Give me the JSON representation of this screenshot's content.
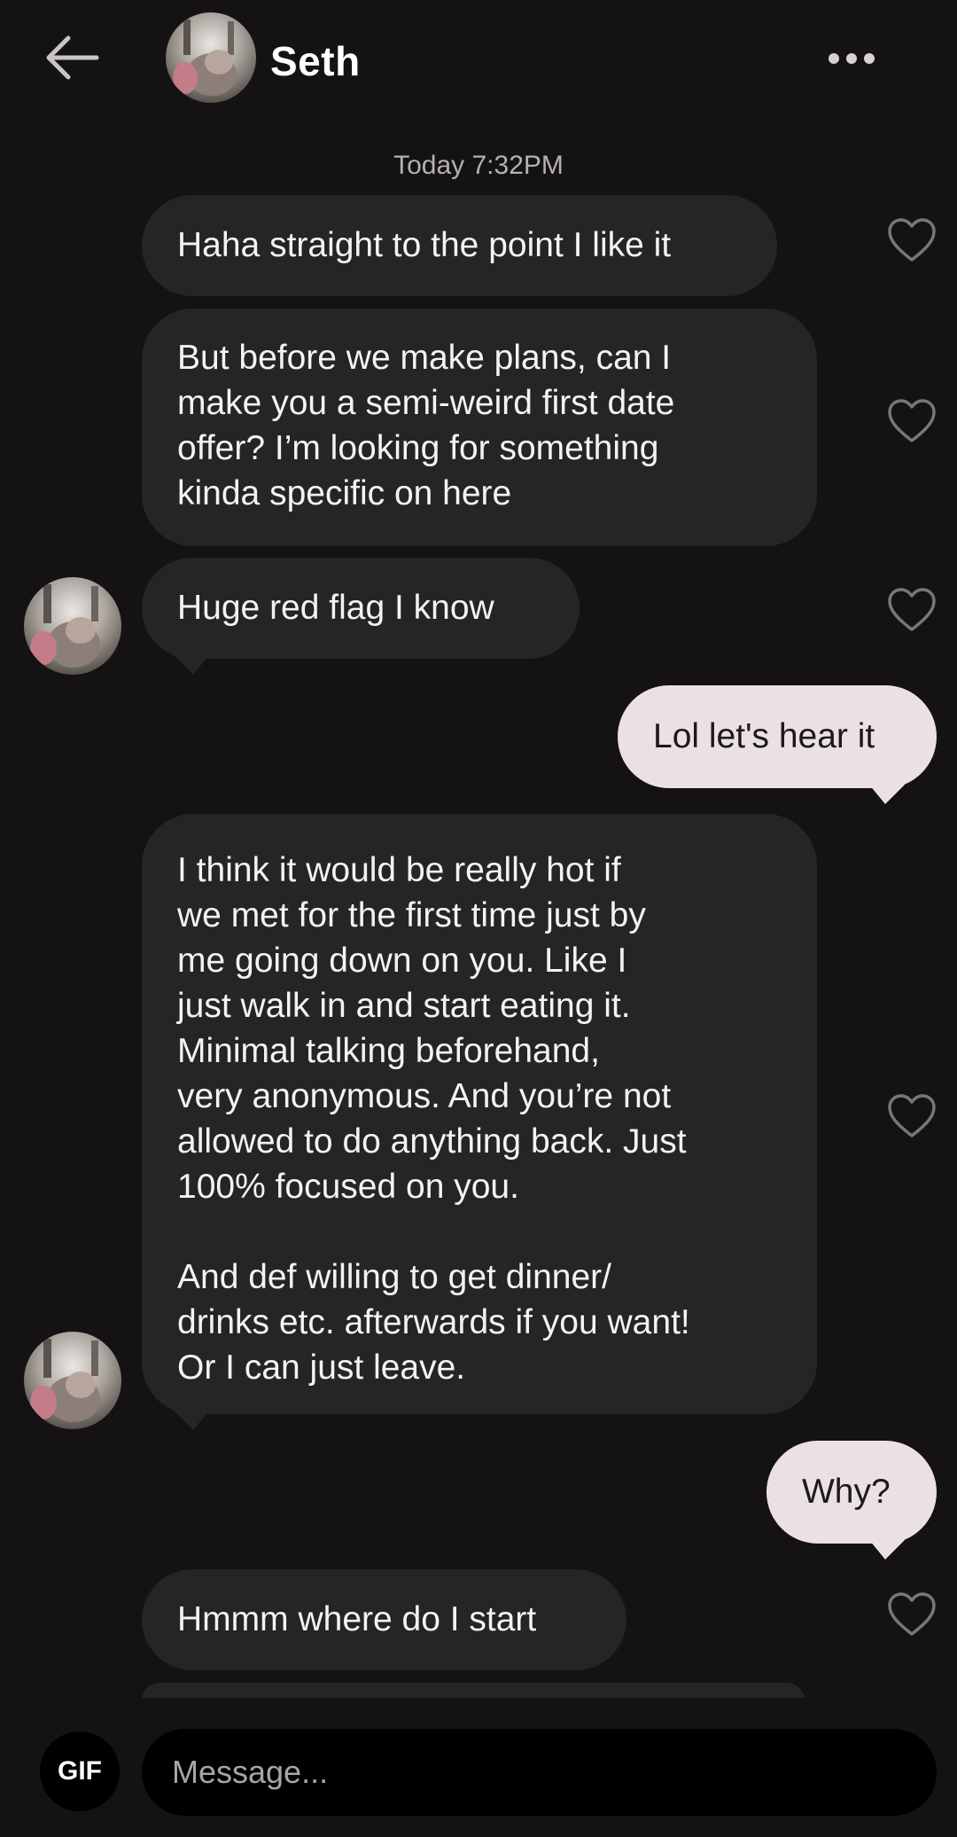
{
  "header": {
    "contact_name": "Seth"
  },
  "timestamp": "Today 7:32PM",
  "messages": [
    {
      "text": "Haha straight to the point I like it"
    },
    {
      "text": "But before we make plans, can I\nmake you a semi-weird first date\noffer? I’m looking for something\nkinda specific on here"
    },
    {
      "text": "Huge red flag I know"
    },
    {
      "text": "Lol let's hear it"
    },
    {
      "text": "I think it would be really hot if\nwe met for the first time just by\nme going down on you. Like I\njust walk in and start eating it.\nMinimal talking beforehand,\nvery anonymous. And you’re not\nallowed to do anything back. Just\n100% focused on you.\n\nAnd def willing to get dinner/\ndrinks etc. afterwards if you want!\nOr I can just leave."
    },
    {
      "text": "Why?"
    },
    {
      "text": "Hmmm where do I start"
    }
  ],
  "composer": {
    "gif_label": "GIF",
    "placeholder": "Message..."
  },
  "colors": {
    "background": "#141213",
    "incoming_bubble": "#262425",
    "outgoing_bubble": "#ebe1e4"
  },
  "icons": [
    "back-arrow-icon",
    "more-options-icon",
    "heart-icon"
  ]
}
